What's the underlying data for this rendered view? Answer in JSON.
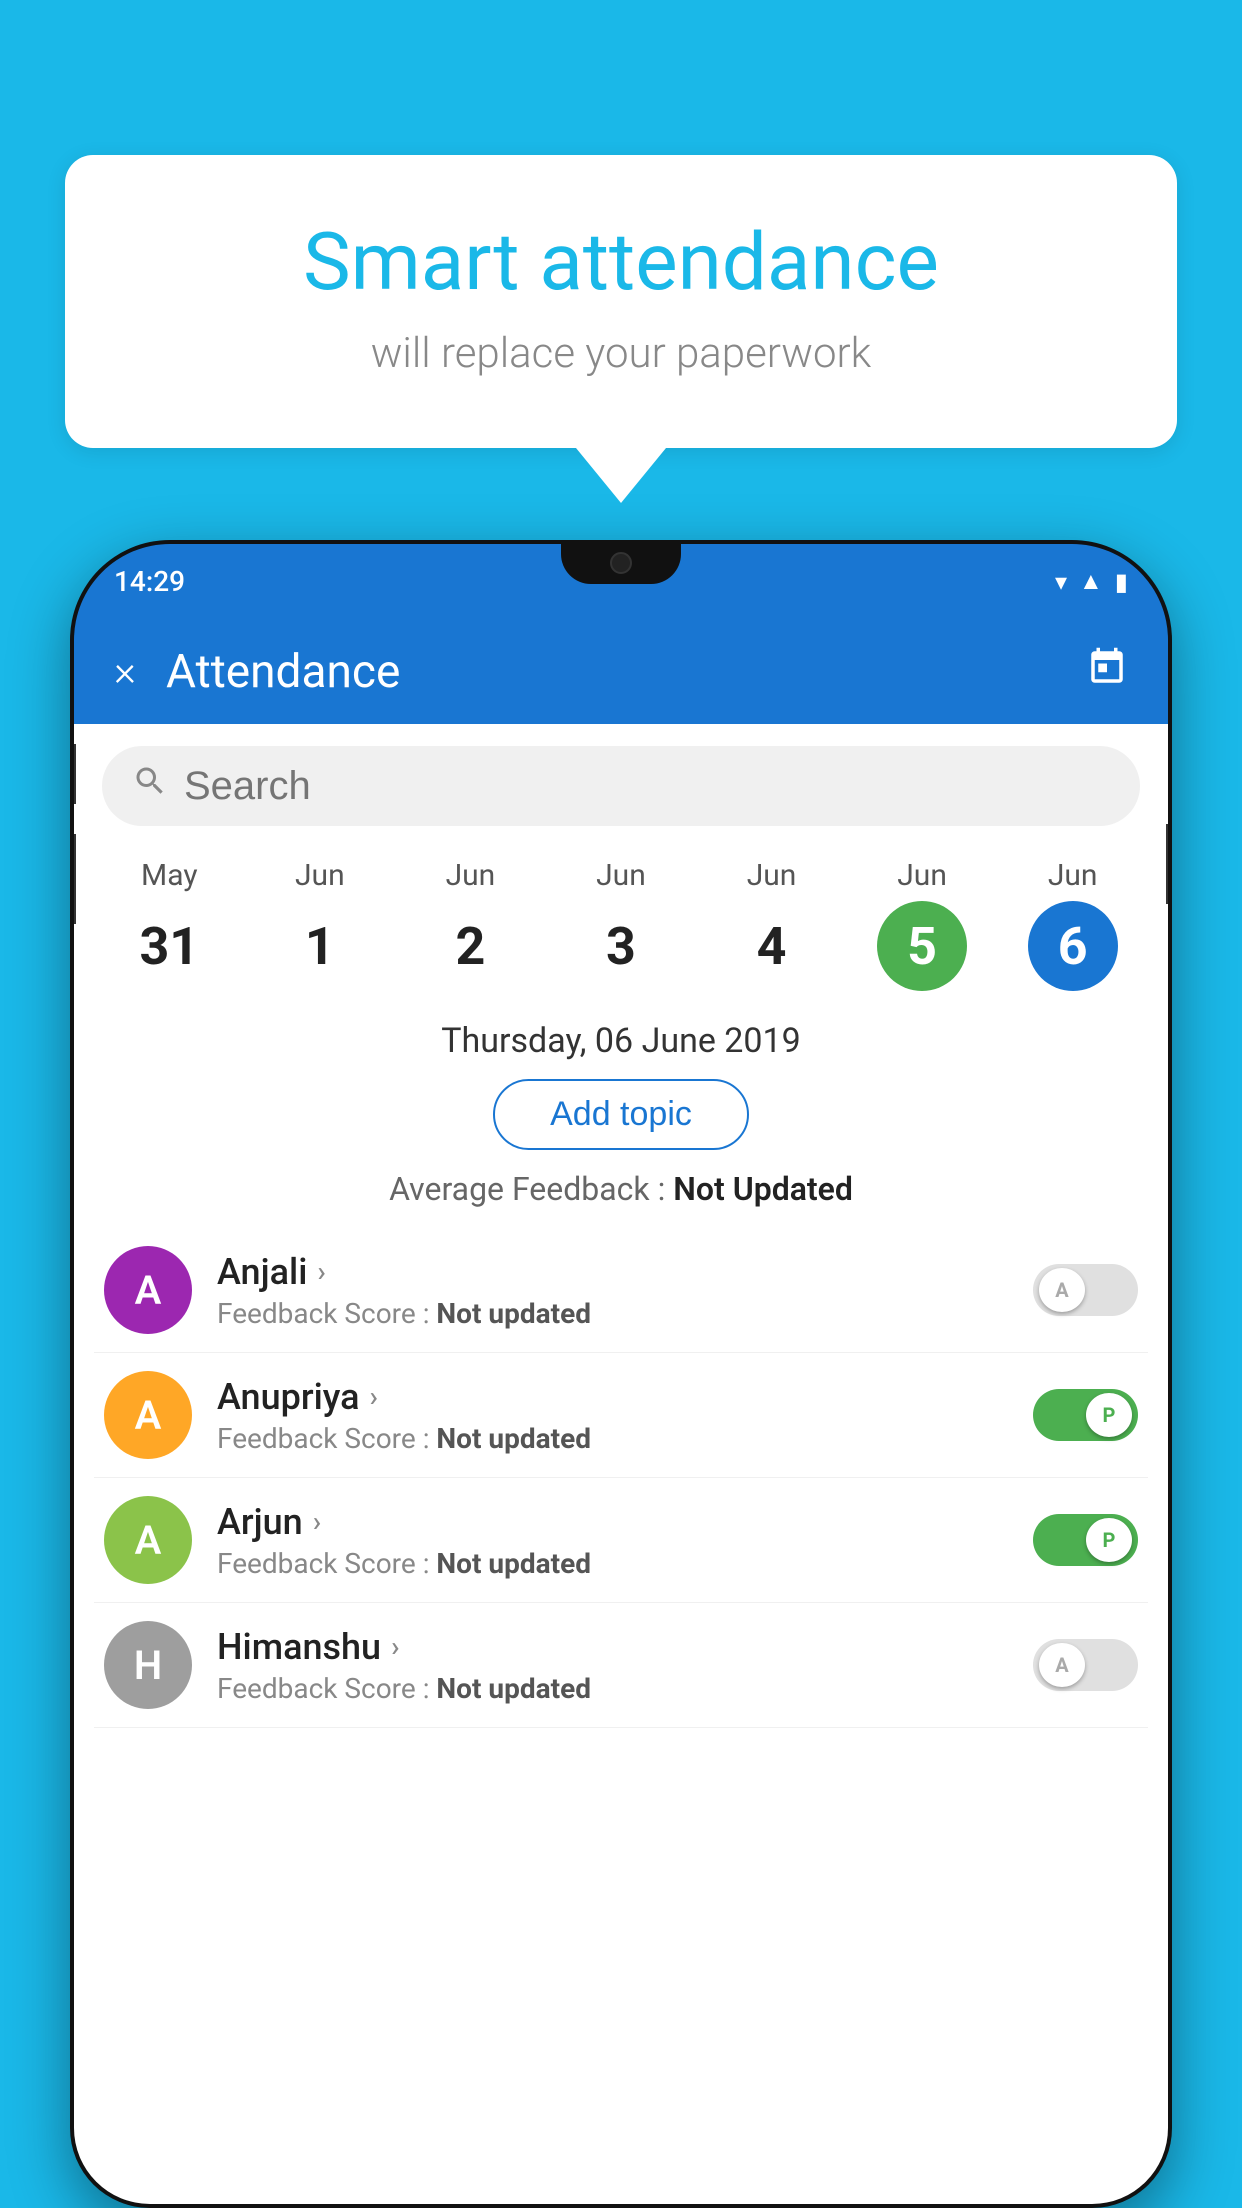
{
  "background_color": "#1ab8e8",
  "speech_bubble": {
    "title": "Smart attendance",
    "subtitle": "will replace your paperwork"
  },
  "status_bar": {
    "time": "14:29",
    "icons": [
      "wifi",
      "signal",
      "battery"
    ]
  },
  "app_bar": {
    "title": "Attendance",
    "close_label": "×",
    "calendar_label": "📅"
  },
  "search": {
    "placeholder": "Search"
  },
  "calendar": {
    "days": [
      {
        "month": "May",
        "date": "31",
        "state": "normal"
      },
      {
        "month": "Jun",
        "date": "1",
        "state": "normal"
      },
      {
        "month": "Jun",
        "date": "2",
        "state": "normal"
      },
      {
        "month": "Jun",
        "date": "3",
        "state": "normal"
      },
      {
        "month": "Jun",
        "date": "4",
        "state": "normal"
      },
      {
        "month": "Jun",
        "date": "5",
        "state": "today"
      },
      {
        "month": "Jun",
        "date": "6",
        "state": "selected"
      }
    ]
  },
  "selected_date": "Thursday, 06 June 2019",
  "add_topic_label": "Add topic",
  "avg_feedback_label": "Average Feedback : ",
  "avg_feedback_value": "Not Updated",
  "students": [
    {
      "name": "Anjali",
      "initial": "A",
      "avatar_color": "#9c27b0",
      "feedback_label": "Feedback Score : ",
      "feedback_value": "Not updated",
      "attendance": "absent",
      "toggle_label": "A"
    },
    {
      "name": "Anupriya",
      "initial": "A",
      "avatar_color": "#ffa726",
      "feedback_label": "Feedback Score : ",
      "feedback_value": "Not updated",
      "attendance": "present",
      "toggle_label": "P"
    },
    {
      "name": "Arjun",
      "initial": "A",
      "avatar_color": "#8bc34a",
      "feedback_label": "Feedback Score : ",
      "feedback_value": "Not updated",
      "attendance": "present",
      "toggle_label": "P"
    },
    {
      "name": "Himanshu",
      "initial": "H",
      "avatar_color": "#9e9e9e",
      "feedback_label": "Feedback Score : ",
      "feedback_value": "Not updated",
      "attendance": "absent",
      "toggle_label": "A"
    }
  ]
}
